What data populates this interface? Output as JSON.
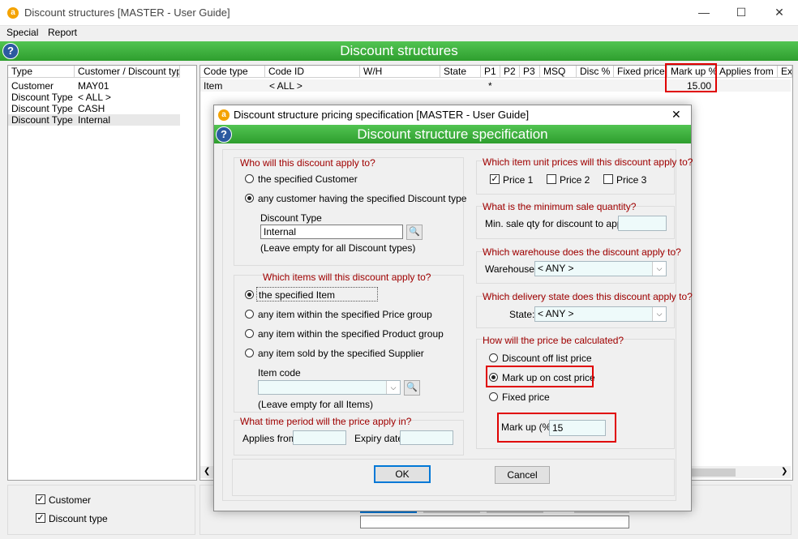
{
  "window": {
    "title": "Discount structures [MASTER - User Guide]",
    "app_icon": "a"
  },
  "menu": [
    "Special",
    "Report"
  ],
  "main_header": "Discount structures",
  "left_table": {
    "headers": [
      "Type",
      "Customer / Discount type"
    ],
    "rows": [
      [
        "Customer",
        "MAY01"
      ],
      [
        "Discount Type",
        "< ALL >"
      ],
      [
        "Discount Type",
        "CASH"
      ],
      [
        "Discount Type",
        "Internal"
      ]
    ]
  },
  "right_table": {
    "headers": [
      "Code type",
      "Code ID",
      "W/H",
      "State",
      "P1",
      "P2",
      "P3",
      "MSQ",
      "Disc %",
      "Fixed price",
      "Mark up %",
      "Applies from",
      "Ex"
    ],
    "row": {
      "code_type": "Item",
      "code_id": "< ALL >",
      "p1": "*",
      "markup": "15.00"
    }
  },
  "bottom_left": {
    "customer_label": "Customer",
    "discount_type_label": "Discount type"
  },
  "dialog": {
    "title": "Discount structure pricing specification [MASTER - User Guide]",
    "header": "Discount structure specification",
    "who": {
      "title": "Who will this discount apply to?",
      "opt_customer": "the specified Customer",
      "opt_discount_type": "any customer having the specified Discount type",
      "field_label": "Discount Type",
      "field_value": "Internal",
      "hint": "(Leave empty for all Discount types)"
    },
    "items": {
      "title": "Which items will this discount apply to?",
      "opt_item": "the specified Item",
      "opt_price_group": "any item within the specified Price group",
      "opt_product_group": "any item within the specified Product group",
      "opt_supplier": "any item sold by the specified Supplier",
      "field_label": "Item code",
      "field_value": "",
      "hint": "(Leave empty for all Items)"
    },
    "period": {
      "title": "What time period will the price apply in?",
      "applies_from": "Applies from:",
      "expiry_date": "Expiry date:"
    },
    "prices": {
      "title": "Which item unit prices will this discount apply to?",
      "price1": "Price 1",
      "price2": "Price 2",
      "price3": "Price 3"
    },
    "min_qty": {
      "title": "What is the minimum sale quantity?",
      "label": "Min. sale qty for discount to apply:",
      "value": ""
    },
    "warehouse": {
      "title": "Which warehouse does the discount apply to?",
      "label": "Warehouse:",
      "value": "< ANY >"
    },
    "state": {
      "title": "Which delivery state does this discount apply to?",
      "label": "State:",
      "value": "< ANY >"
    },
    "calc": {
      "title": "How will the price be calculated?",
      "opt_discount": "Discount off list price",
      "opt_markup": "Mark up on cost price",
      "opt_fixed": "Fixed price",
      "markup_label": "Mark up (%)",
      "markup_value": "15"
    },
    "ok": "OK",
    "cancel": "Cancel"
  },
  "colors": {
    "green": "#3aaa3a",
    "highlight_red": "#e00000",
    "group_title": "#a00000"
  }
}
